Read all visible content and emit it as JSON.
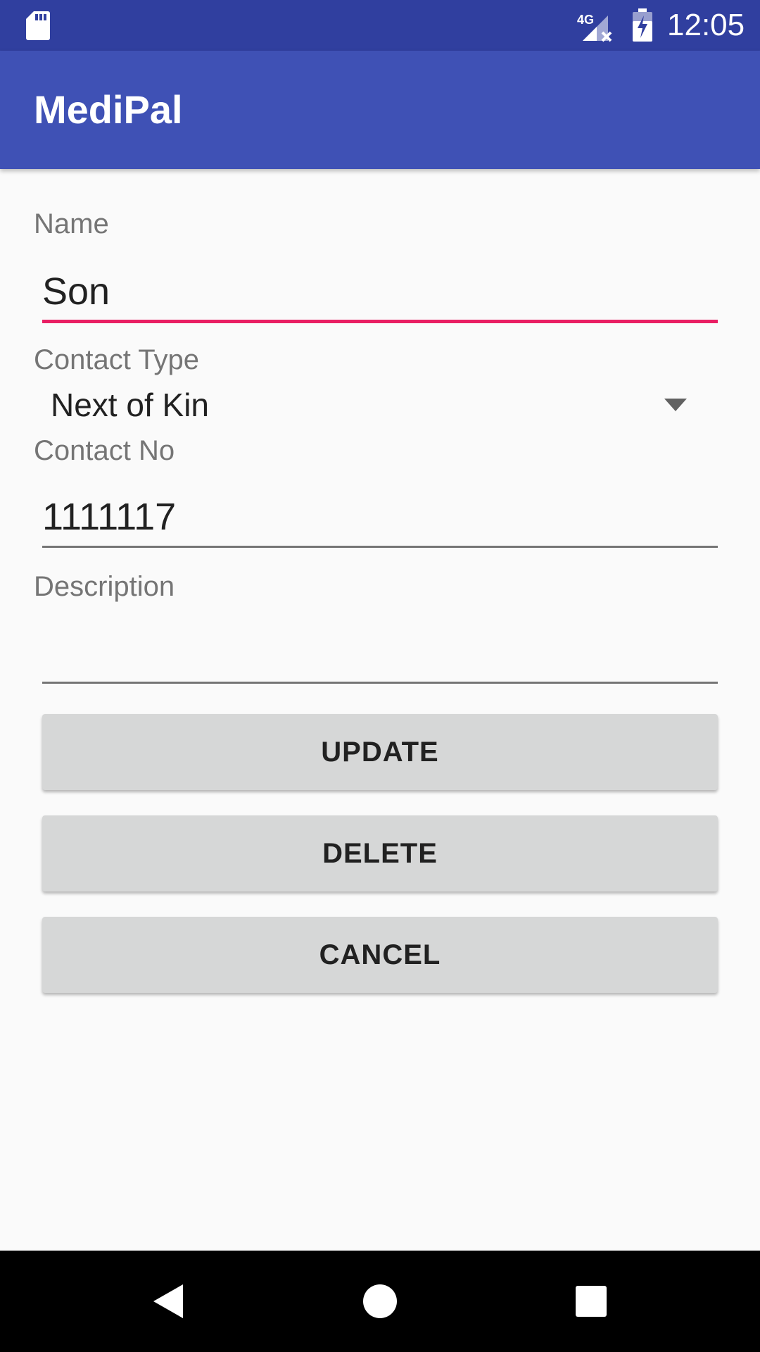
{
  "status_bar": {
    "time": "12:05",
    "network_label": "4G",
    "icons": [
      "sd-card-icon",
      "signal-4g-icon",
      "battery-charging-icon"
    ]
  },
  "app_bar": {
    "title": "MediPal"
  },
  "form": {
    "name": {
      "label": "Name",
      "value": "Son"
    },
    "contact_type": {
      "label": "Contact Type",
      "selected": "Next of Kin"
    },
    "contact_no": {
      "label": "Contact No",
      "value": "1111117"
    },
    "description": {
      "label": "Description",
      "value": ""
    }
  },
  "buttons": {
    "update": "UPDATE",
    "delete": "DELETE",
    "cancel": "CANCEL"
  },
  "nav_bar": {
    "icons": [
      "back-icon",
      "home-icon",
      "recents-icon"
    ]
  },
  "colors": {
    "status_bar": "#303F9F",
    "app_bar": "#3F51B5",
    "focused_underline": "#E91E63",
    "button": "#D6D7D7",
    "background": "#FAFAFA"
  }
}
